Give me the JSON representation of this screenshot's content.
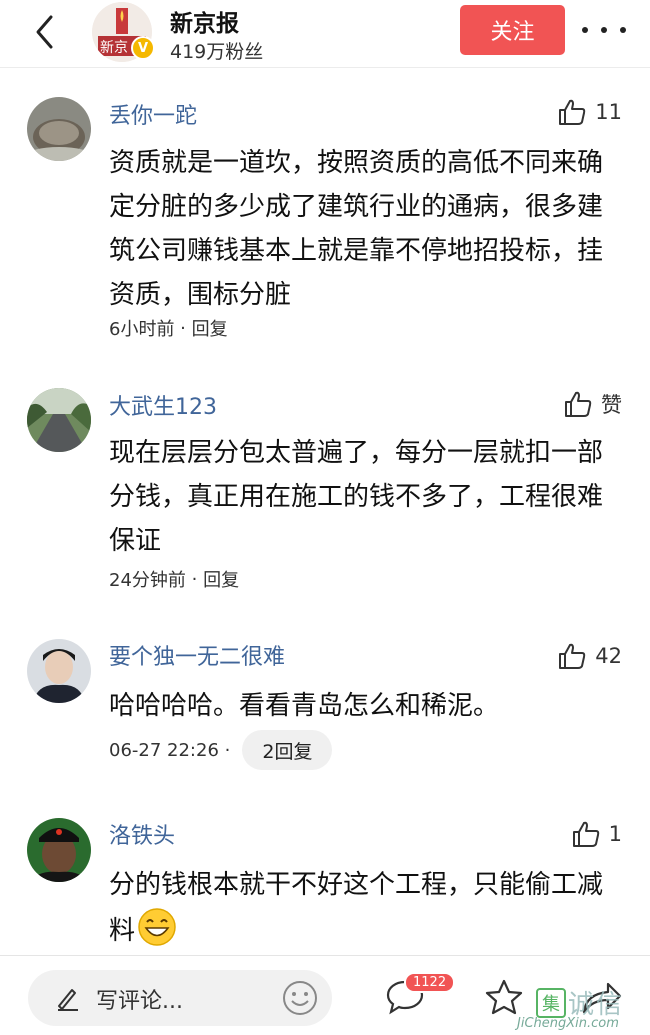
{
  "header": {
    "account_name": "新京报",
    "verified_mark": "V",
    "fans": "419万粉丝",
    "follow_label": "关注",
    "logo_text": "新京"
  },
  "comments": [
    {
      "user": "丢你一跎",
      "likes": "11",
      "text": "资质就是一道坎，按照资质的高低不同来确定分脏的多少成了建筑行业的通病，很多建筑公司赚钱基本上就是靠不停地招投标，挂资质，围标分脏",
      "time": "6小时前",
      "reply": "回复"
    },
    {
      "user": "大武生123",
      "likes": "赞",
      "text": "现在层层分包太普遍了，每分一层就扣一部分钱，真正用在施工的钱不多了，工程很难保证",
      "time": "24分钟前",
      "reply": "回复"
    },
    {
      "user": "要个独一无二很难",
      "likes": "42",
      "text": "哈哈哈哈。看看青岛怎么和稀泥。",
      "time": "06-27 22:26",
      "reply": "2回复"
    },
    {
      "user": "洛铁头",
      "likes": "1",
      "text": "分的钱根本就干不好这个工程，只能偷工减料"
    }
  ],
  "bottom_bar": {
    "input_placeholder": "写评论...",
    "comment_count": "1122"
  },
  "watermark": {
    "box": "集",
    "text": "诚信",
    "url": "JiChengXin.com"
  },
  "colors": {
    "accent": "#f15454",
    "username": "#406599"
  }
}
